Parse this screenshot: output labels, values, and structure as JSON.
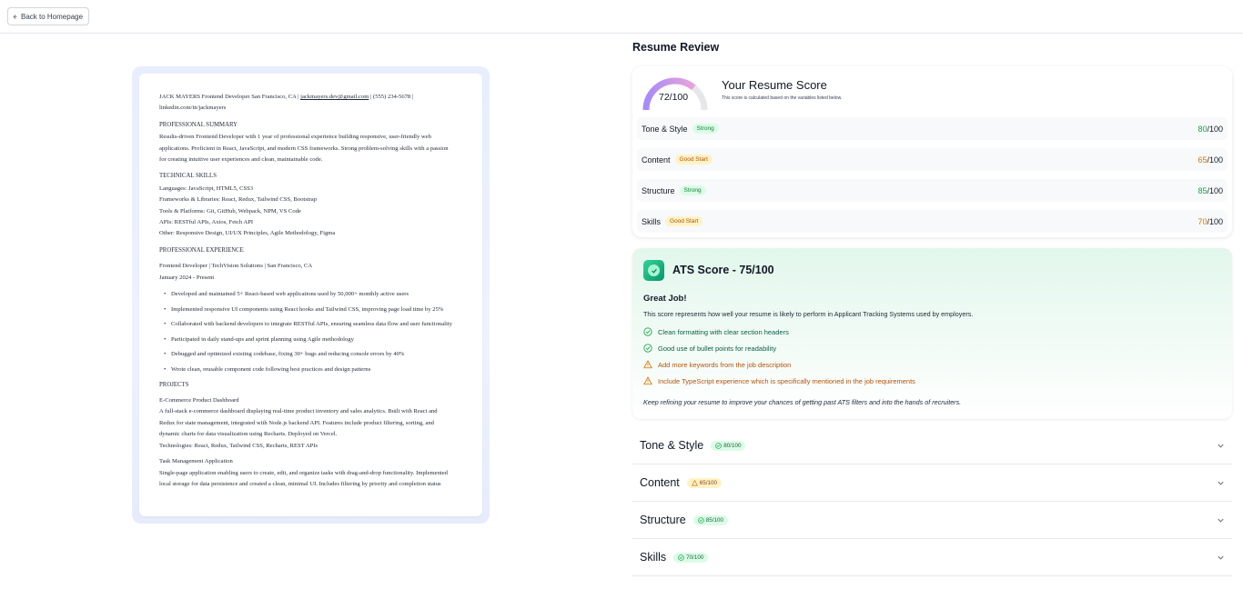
{
  "topbar": {
    "back_label": "Back to Homepage"
  },
  "resume": {
    "header_name_line": "JACK MAYERS Frontend Developer San Francisco, CA | ",
    "email": "jackmayers.dev@gmail.com",
    "phone_part": " | (555) 234-5678 |",
    "linkedin": "linkedin.com/in/jackmayers",
    "summary_title": "PROFESSIONAL SUMMARY",
    "summary_lines": [
      "Results-driven Frontend Developer with 1 year of professional experience building responsive, user-friendly web",
      "applications. Proficient in React, JavaScript, and modern CSS frameworks. Strong problem-solving skills with a passion",
      "for creating intuitive user experiences and clean, maintainable code."
    ],
    "skills_title": "TECHNICAL SKILLS",
    "skills_lines": [
      "Languages: JavaScript, HTML5, CSS3",
      "Frameworks & Libraries: React, Redux, Tailwind CSS, Bootstrap",
      "Tools & Platforms: Git, GitHub, Webpack, NPM, VS Code",
      "APIs: RESTful APIs, Axios, Fetch API",
      "Other: Responsive Design, UI/UX Principles, Agile Methodology, Figma"
    ],
    "experience_title": "PROFESSIONAL EXPERIENCE",
    "job_title": "Frontend Developer | TechVision Solutions | San Francisco, CA",
    "job_dates": "January 2024 - Present",
    "bullets": [
      "Developed and maintained 5+ React-based web applications used by 50,000+ monthly active users",
      "Implemented responsive UI components using React hooks and Tailwind CSS, improving page load time by 25%",
      "Collaborated with backend developers to integrate RESTful APIs, ensuring seamless data flow and user functionality",
      "Participated in daily stand-ups and sprint planning using Agile methodology",
      "Debugged and optimized existing codebase, fixing 30+ bugs and reducing console errors by 40%",
      "Wrote clean, reusable component code following best practices and design patterns"
    ],
    "projects_title": "PROJECTS",
    "project1_name": "E-Commerce Product Dashboard",
    "project1_lines": [
      "A full-stack e-commerce dashboard displaying real-time product inventory and sales analytics. Built with React and",
      "Redux for state management, integrated with Node.js backend API. Features include product filtering, sorting, and",
      "dynamic charts for data visualization using Recharts. Deployed on Vercel.",
      "Technologies: React, Redux, Tailwind CSS, Recharts, REST APIs"
    ],
    "project2_name": "Task Management Application",
    "project2_lines": [
      "Single-page application enabling users to create, edit, and organize tasks with drag-and-drop functionality. Implemented",
      "local storage for data persistence and created a clean, minimal UI. Includes filtering by priority and completion status"
    ]
  },
  "review": {
    "title": "Resume Review",
    "score_value": 72,
    "score_text": "72/100",
    "score_heading": "Your Resume Score",
    "score_sub": "This score is calculated based on the variables listed below.",
    "categories": [
      {
        "name": "Tone & Style",
        "badge": "Strong",
        "score": "80",
        "suffix": "/100",
        "tone": "green"
      },
      {
        "name": "Content",
        "badge": "Good Start",
        "score": "65",
        "suffix": "/100",
        "tone": "amber"
      },
      {
        "name": "Structure",
        "badge": "Strong",
        "score": "85",
        "suffix": "/100",
        "tone": "green"
      },
      {
        "name": "Skills",
        "badge": "Good Start",
        "score": "70",
        "suffix": "/100",
        "tone": "amber"
      }
    ]
  },
  "ats": {
    "title": "ATS Score - 75/100",
    "headline": "Great Job!",
    "description": "This score represents how well your resume is likely to perform in Applicant Tracking Systems used by employers.",
    "items": [
      {
        "text": "Clean formatting with clear section headers",
        "type": "good"
      },
      {
        "text": "Good use of bullet points for readability",
        "type": "good"
      },
      {
        "text": "Add more keywords from the job description",
        "type": "warn"
      },
      {
        "text": "Include TypeScript experience which is specifically mentioned in the job requirements",
        "type": "warn"
      }
    ],
    "footer": "Keep refining your resume to improve your chances of getting past ATS filters and into the hands of recruiters."
  },
  "accordion": [
    {
      "title": "Tone & Style",
      "badge": "80/100",
      "tone": "green"
    },
    {
      "title": "Content",
      "badge": "65/100",
      "tone": "amber"
    },
    {
      "title": "Structure",
      "badge": "85/100",
      "tone": "green"
    },
    {
      "title": "Skills",
      "badge": "70/100",
      "tone": "green"
    }
  ],
  "colors": {
    "good": "#16a34a",
    "warn": "#d97706",
    "gauge_start": "#a78bfa",
    "gauge_end": "#f9a8d4"
  },
  "icons": {
    "back": "arrow-left-icon",
    "ats": "check-badge-icon",
    "good": "check-circle-icon",
    "warn": "warning-triangle-icon",
    "chevron": "chevron-down-icon"
  }
}
